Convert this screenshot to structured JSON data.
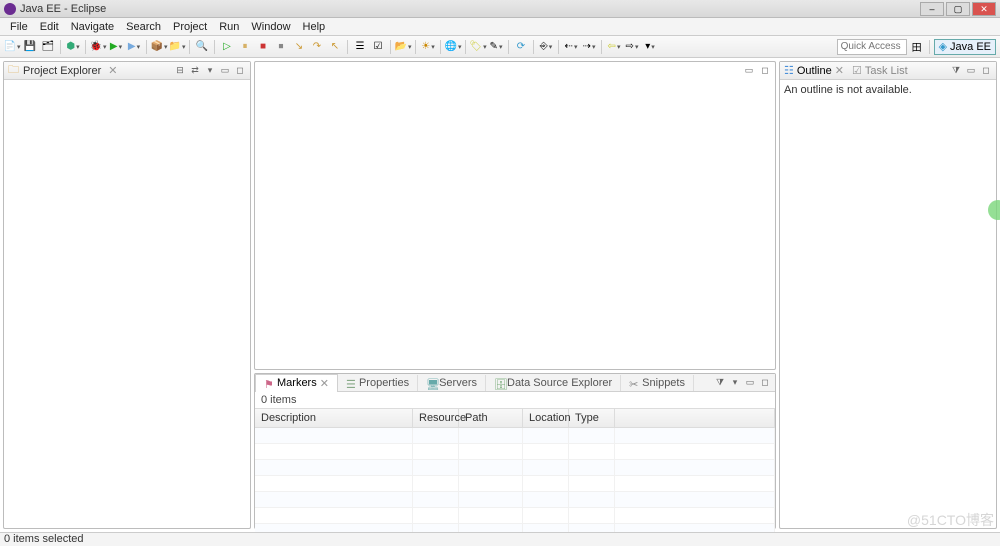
{
  "window": {
    "title": "Java EE - Eclipse"
  },
  "menu": [
    "File",
    "Edit",
    "Navigate",
    "Search",
    "Project",
    "Run",
    "Window",
    "Help"
  ],
  "quick_access": {
    "placeholder": "Quick Access"
  },
  "perspective": {
    "label": "Java EE"
  },
  "project_explorer": {
    "title": "Project Explorer"
  },
  "outline": {
    "title": "Outline",
    "tasklist_title": "Task List",
    "empty_text": "An outline is not available."
  },
  "bottom_tabs": {
    "markers": "Markers",
    "properties": "Properties",
    "servers": "Servers",
    "data_source_explorer": "Data Source Explorer",
    "snippets": "Snippets"
  },
  "markers": {
    "count_text": "0 items",
    "columns": {
      "description": "Description",
      "resource": "Resource",
      "path": "Path",
      "location": "Location",
      "type": "Type"
    }
  },
  "status": {
    "text": "0 items selected"
  },
  "watermark": "@51CTO博客"
}
